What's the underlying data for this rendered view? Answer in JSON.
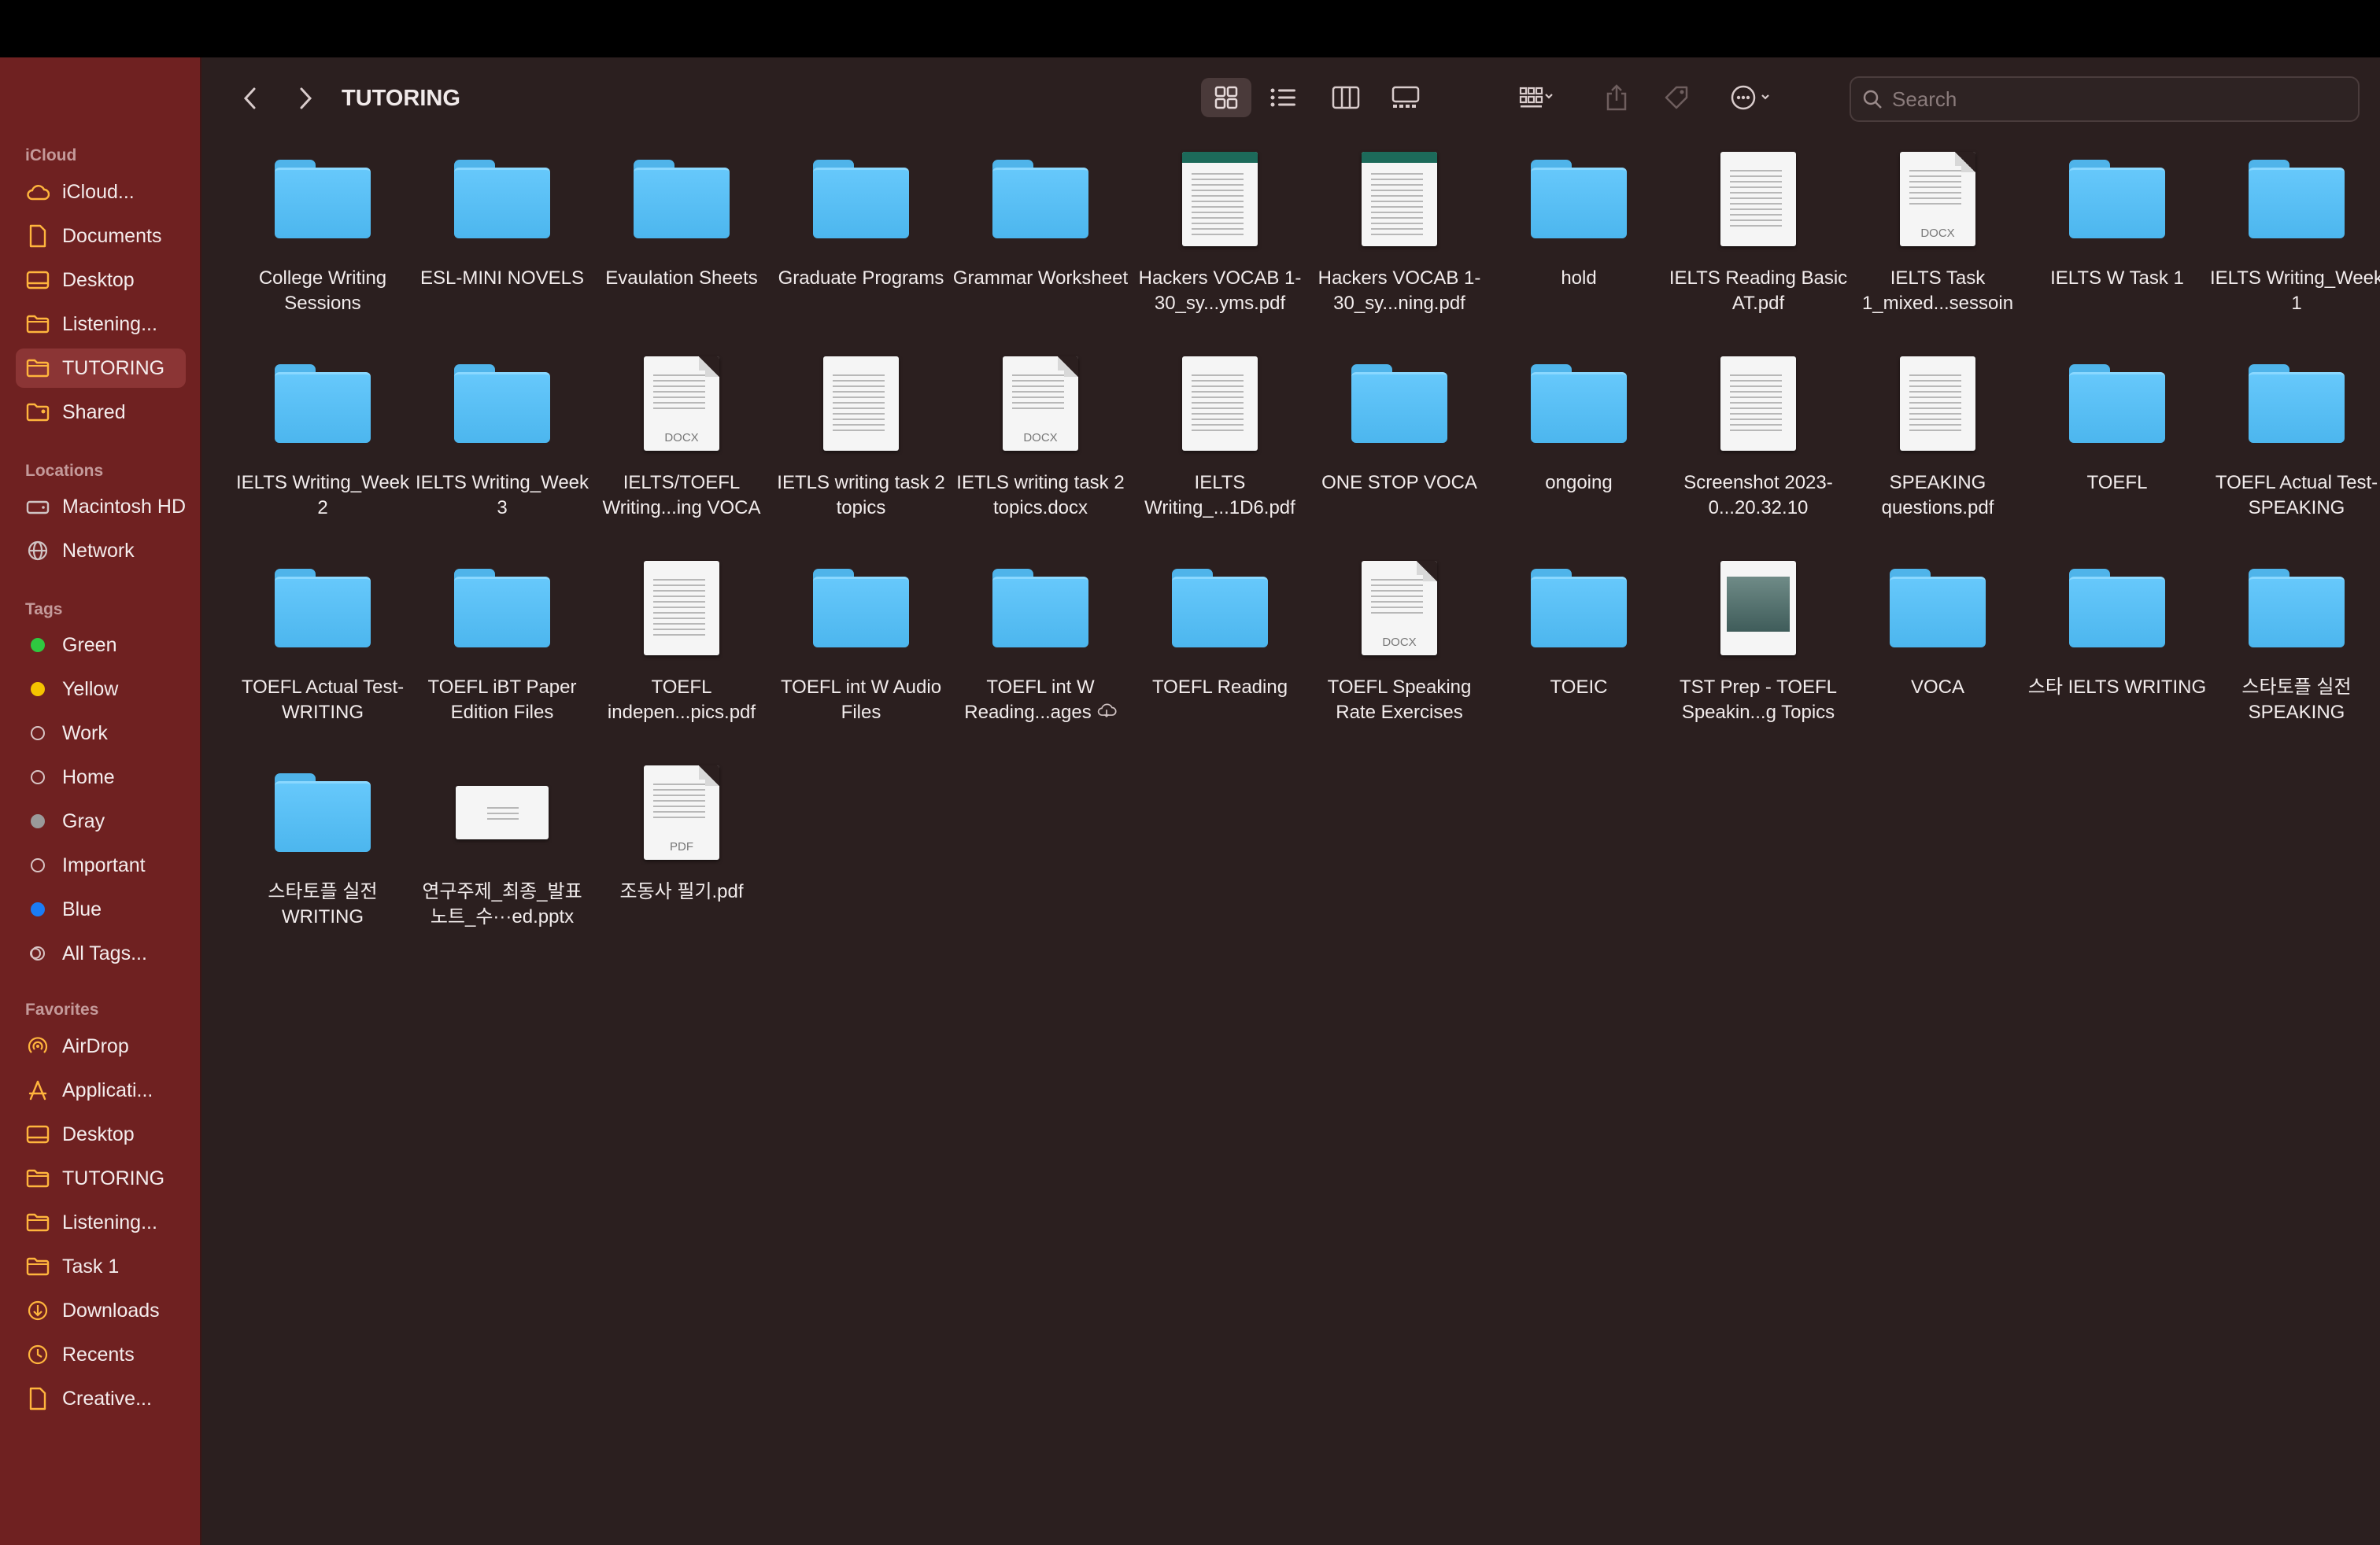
{
  "window": {
    "title": "TUTORING"
  },
  "toolbar": {
    "search_placeholder": "Search",
    "view_icons": [
      "grid-view-icon",
      "list-view-icon",
      "column-view-icon",
      "gallery-view-icon",
      "group-by-icon",
      "share-icon",
      "tag-icon",
      "more-actions-icon"
    ]
  },
  "sidebar": {
    "icloud_header": "iCloud",
    "icloud": [
      {
        "label": "iCloud...",
        "icon": "cloud-icon"
      },
      {
        "label": "Documents",
        "icon": "document-icon"
      },
      {
        "label": "Desktop",
        "icon": "desktop-icon"
      },
      {
        "label": "Listening...",
        "icon": "folder-icon"
      },
      {
        "label": "TUTORING",
        "icon": "folder-icon",
        "selected": true
      },
      {
        "label": "Shared",
        "icon": "shared-folder-icon"
      }
    ],
    "locations_header": "Locations",
    "locations": [
      {
        "label": "Macintosh HD",
        "icon": "disk-icon"
      },
      {
        "label": "Network",
        "icon": "network-icon"
      }
    ],
    "tags_header": "Tags",
    "tags": [
      {
        "label": "Green",
        "color": "#2fc840"
      },
      {
        "label": "Yellow",
        "color": "#f5c400"
      },
      {
        "label": "Work",
        "color": ""
      },
      {
        "label": "Home",
        "color": ""
      },
      {
        "label": "Gray",
        "color": "#9a9a9a"
      },
      {
        "label": "Important",
        "color": ""
      },
      {
        "label": "Blue",
        "color": "#1a7cf5"
      },
      {
        "label": "All Tags...",
        "color": "all"
      }
    ],
    "favorites_header": "Favorites",
    "favorites": [
      {
        "label": "AirDrop",
        "icon": "airdrop-icon"
      },
      {
        "label": "Applicati...",
        "icon": "applications-icon"
      },
      {
        "label": "Desktop",
        "icon": "desktop-icon"
      },
      {
        "label": "TUTORING",
        "icon": "folder-icon"
      },
      {
        "label": "Listening...",
        "icon": "folder-icon"
      },
      {
        "label": "Task 1",
        "icon": "folder-icon"
      },
      {
        "label": "Downloads",
        "icon": "download-icon"
      },
      {
        "label": "Recents",
        "icon": "clock-icon"
      },
      {
        "label": "Creative...",
        "icon": "document-icon"
      }
    ]
  },
  "files": [
    {
      "name": "College Writing Sessions",
      "kind": "folder"
    },
    {
      "name": "ESL-MINI NOVELS",
      "kind": "folder"
    },
    {
      "name": "Evaulation Sheets",
      "kind": "folder"
    },
    {
      "name": "Graduate Programs",
      "kind": "folder"
    },
    {
      "name": "Grammar Worksheet",
      "kind": "folder"
    },
    {
      "name": "Hackers VOCAB 1-30_sy...yms.pdf",
      "kind": "pdf-green"
    },
    {
      "name": "Hackers VOCAB 1-30_sy...ning.pdf",
      "kind": "pdf-green"
    },
    {
      "name": "hold",
      "kind": "folder"
    },
    {
      "name": "IELTS Reading Basic AT.pdf",
      "kind": "pdf"
    },
    {
      "name": "IELTS Task 1_mixed...sessoin",
      "kind": "docx",
      "badge": "DOCX"
    },
    {
      "name": "IELTS W Task 1",
      "kind": "folder"
    },
    {
      "name": "IELTS Writing_Week 1",
      "kind": "folder"
    },
    {
      "name": "IELTS Writing_Week 2",
      "kind": "folder"
    },
    {
      "name": "IELTS Writing_Week 3",
      "kind": "folder"
    },
    {
      "name": "IELTS/TOEFL Writing...ing VOCA",
      "kind": "docx",
      "badge": "DOCX"
    },
    {
      "name": "IETLS writing task 2 topics",
      "kind": "pdf"
    },
    {
      "name": "IETLS writing task 2 topics.docx",
      "kind": "docx",
      "badge": "DOCX"
    },
    {
      "name": "IELTS Writing_...1D6.pdf",
      "kind": "pdf"
    },
    {
      "name": "ONE STOP VOCA",
      "kind": "folder"
    },
    {
      "name": "ongoing",
      "kind": "folder"
    },
    {
      "name": "Screenshot 2023-0...20.32.10",
      "kind": "pdf"
    },
    {
      "name": "SPEAKING questions.pdf",
      "kind": "pdf"
    },
    {
      "name": "TOEFL",
      "kind": "folder"
    },
    {
      "name": "TOEFL Actual Test-SPEAKING",
      "kind": "folder"
    },
    {
      "name": "TOEFL Actual Test-WRITING",
      "kind": "folder"
    },
    {
      "name": "TOEFL iBT Paper Edition Files",
      "kind": "folder"
    },
    {
      "name": "TOEFL indepen...pics.pdf",
      "kind": "pdf"
    },
    {
      "name": "TOEFL int W Audio Files",
      "kind": "folder"
    },
    {
      "name": "TOEFL int W Reading...ages",
      "kind": "folder",
      "cloud": true
    },
    {
      "name": "TOEFL Reading",
      "kind": "folder"
    },
    {
      "name": "TOEFL Speaking Rate Exercises",
      "kind": "docx",
      "badge": "DOCX"
    },
    {
      "name": "TOEIC",
      "kind": "folder"
    },
    {
      "name": "TST Prep - TOEFL Speakin...g Topics",
      "kind": "pdf-photo"
    },
    {
      "name": "VOCA",
      "kind": "folder"
    },
    {
      "name": "스타 IELTS WRITING",
      "kind": "folder"
    },
    {
      "name": "스타토플 실전 SPEAKING",
      "kind": "folder"
    },
    {
      "name": "스타토플 실전 WRITING",
      "kind": "folder"
    },
    {
      "name": "연구주제_최종_발표 노트_수···ed.pptx",
      "kind": "pptx"
    },
    {
      "name": "조동사 필기.pdf",
      "kind": "docx",
      "badge": "PDF"
    }
  ]
}
